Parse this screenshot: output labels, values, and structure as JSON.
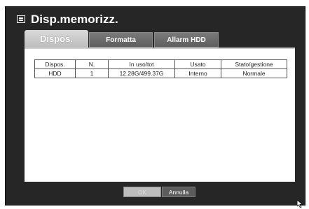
{
  "window": {
    "title": "Disp.memorizz.",
    "title_icon": "hdd-panel-icon"
  },
  "tabs": [
    {
      "label": "Dispos.",
      "active": true
    },
    {
      "label": "Formatta",
      "active": false
    },
    {
      "label": "Allarm HDD",
      "active": false
    }
  ],
  "table": {
    "headers": [
      "Dispos.",
      "N.",
      "In uso/tot",
      "Usato",
      "Stato/gestione"
    ],
    "rows": [
      [
        "HDD",
        "1",
        "12.28G/499.37G",
        "Interno",
        "Normale"
      ]
    ]
  },
  "buttons": {
    "ok": "OK",
    "cancel": "Annulla"
  },
  "colors": {
    "dialog_bg": "#262626",
    "panel_bg": "#ffffff",
    "tab_active": "#cfcfcf",
    "tab_inactive": "#6b6b6b"
  }
}
